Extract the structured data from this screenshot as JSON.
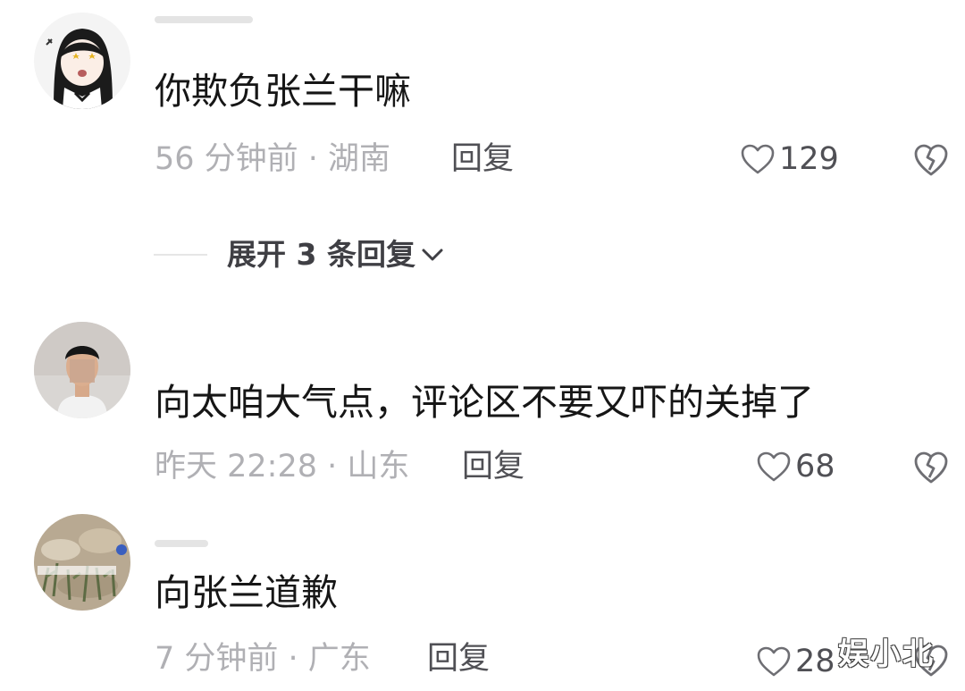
{
  "comments": [
    {
      "text": "你欺负张兰干嘛",
      "meta": "56 分钟前 · 湖南",
      "reply_label": "回复",
      "likes": "129",
      "avatar_icon": "anime-girl-avatar-icon"
    },
    {
      "text": "向太咱大气点，评论区不要又吓的关掉了",
      "meta": "昨天 22:28 · 山东",
      "reply_label": "回复",
      "likes": "68",
      "avatar_icon": "man-photo-avatar-icon"
    },
    {
      "text": "向张兰道歉",
      "meta": "7 分钟前 · 广东",
      "reply_label": "回复",
      "likes": "28",
      "avatar_icon": "grass-photo-avatar-icon"
    }
  ],
  "expand_replies": {
    "label": "展开 3 条回复"
  },
  "watermark": "娱小北",
  "colors": {
    "text": "#161616",
    "meta": "#b0b0b4",
    "action": "#505055"
  }
}
